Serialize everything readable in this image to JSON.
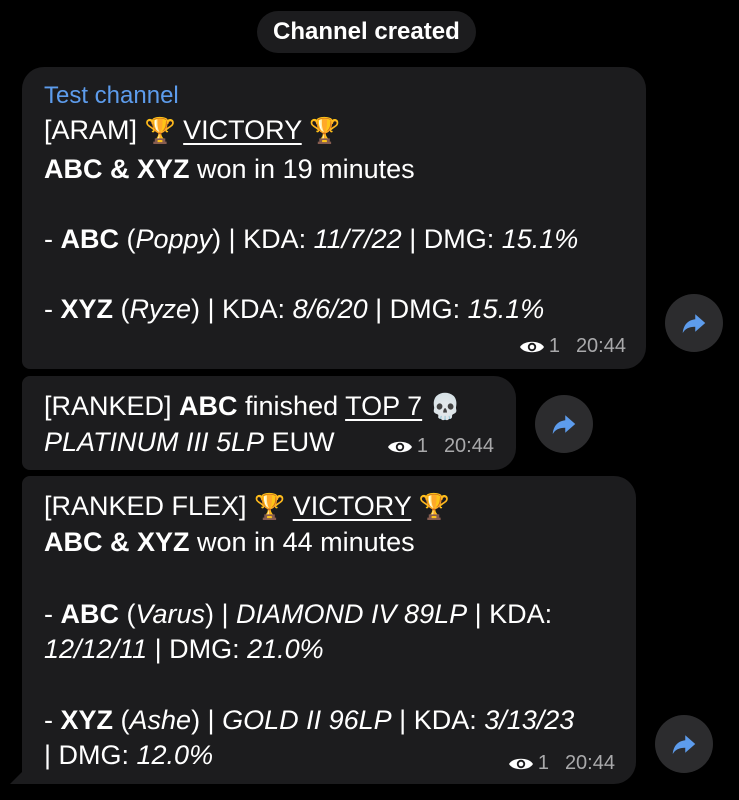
{
  "service_message": "Channel created",
  "messages": [
    {
      "channel_name": "Test channel",
      "line1": {
        "queue": "[ARAM] ",
        "trophy_left": "🏆",
        "result": "VICTORY",
        "trophy_right": "🏆"
      },
      "line2": {
        "players": "ABC & XYZ",
        "rest": " won in 19 minutes"
      },
      "player1": {
        "prefix": "- ",
        "name": "ABC",
        "champ_open": " (",
        "champion": "Poppy",
        "champ_close": ") | KDA: ",
        "kda": "11/7/22",
        "dmg_label": " | DMG: ",
        "dmg": "15.1%"
      },
      "player2": {
        "prefix": "- ",
        "name": "XYZ",
        "champ_open": " (",
        "champion": "Ryze",
        "champ_close": ") | KDA: ",
        "kda": "8/6/20",
        "dmg_label": " | DMG: ",
        "dmg": "15.1%"
      },
      "views": "1",
      "time": "20:44"
    },
    {
      "line1": {
        "queue": "[RANKED] ",
        "player": "ABC",
        "mid": " finished ",
        "placement": "TOP 7",
        "skull": "💀"
      },
      "line2": {
        "rank": "PLATINUM III 5LP",
        "region": " EUW"
      },
      "views": "1",
      "time": "20:44"
    },
    {
      "line1": {
        "queue": "[RANKED FLEX] ",
        "trophy_left": "🏆",
        "result": "VICTORY",
        "trophy_right": "🏆"
      },
      "line2": {
        "players": "ABC & XYZ",
        "rest": " won in 44 minutes"
      },
      "player1": {
        "prefix": "- ",
        "name": "ABC",
        "champ_open": " (",
        "champion": "Varus",
        "champ_close": ") | ",
        "rank": "DIAMOND IV 89LP",
        "kda_label": " | KDA:",
        "kda": "12/12/11",
        "dmg_label": " | DMG: ",
        "dmg": "21.0%"
      },
      "player2": {
        "prefix": "- ",
        "name": "XYZ",
        "champ_open": " (",
        "champion": "Ashe",
        "champ_close": ") | ",
        "rank": "GOLD II 96LP",
        "kda_label": " | KDA: ",
        "kda": "3/13/23",
        "dmg_prefix": "| DMG: ",
        "dmg": "12.0%"
      },
      "views": "1",
      "time": "20:44"
    }
  ],
  "icons": {
    "views": "eye-icon",
    "share": "share-arrow-icon"
  },
  "colors": {
    "background": "#000000",
    "bubble": "#1c1c1e",
    "channel_name": "#5d9cec",
    "meta": "#a9a9ab",
    "share_button": "#2c2c2e",
    "share_arrow": "#5d9cec"
  }
}
